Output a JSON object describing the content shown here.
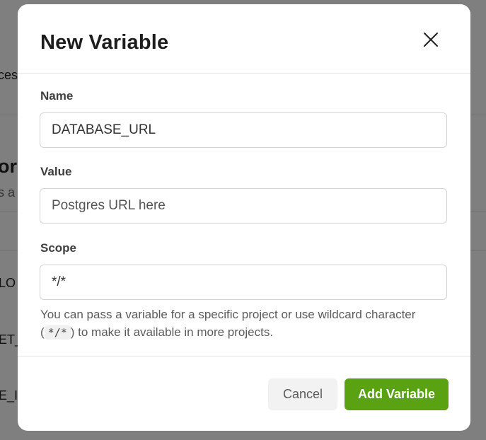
{
  "background": {
    "fragments": [
      "ces",
      "or",
      "s a",
      "LO",
      "ET_",
      "E_I"
    ]
  },
  "modal": {
    "title": "New Variable",
    "close_icon": "close-icon",
    "fields": {
      "name": {
        "label": "Name",
        "value": "DATABASE_URL",
        "placeholder": ""
      },
      "value": {
        "label": "Value",
        "value": "",
        "placeholder": "Postgres URL here"
      },
      "scope": {
        "label": "Scope",
        "value": "*/*",
        "placeholder": ""
      }
    },
    "help": {
      "before": "You can pass a variable for a specific project or use wildcard character (",
      "code": "*/*",
      "after": ") to make it available in more projects."
    },
    "buttons": {
      "cancel": "Cancel",
      "submit": "Add Variable"
    }
  },
  "colors": {
    "primary": "#5aa211",
    "overlay": "#000000"
  }
}
